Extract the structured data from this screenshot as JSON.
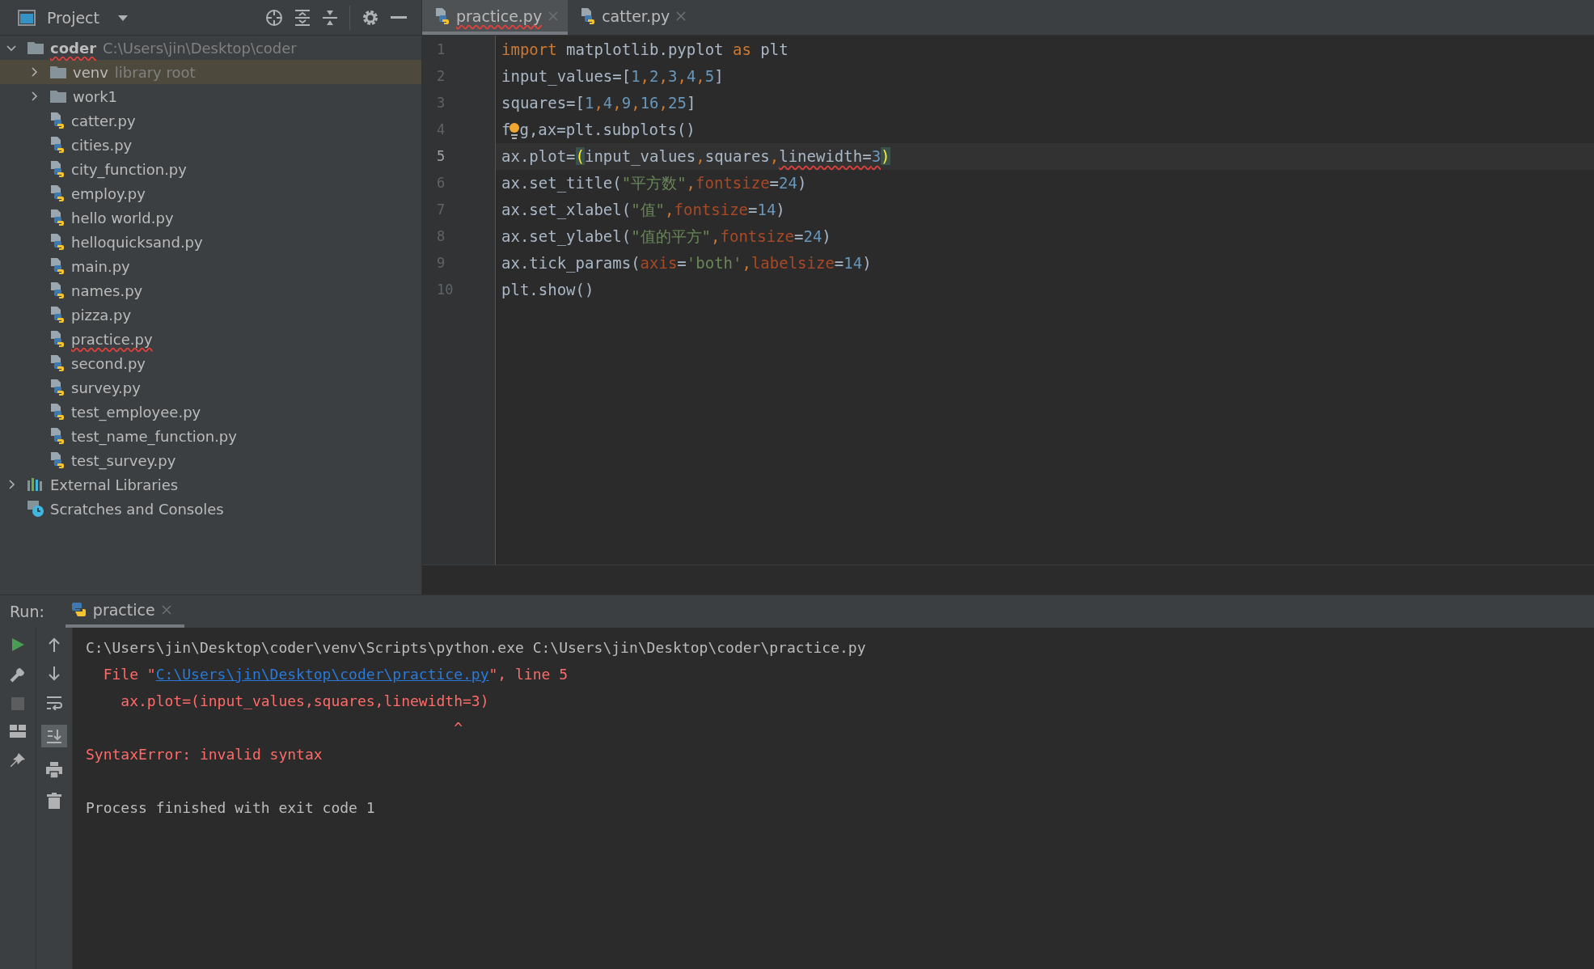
{
  "project_panel": {
    "title": "Project",
    "tree": [
      {
        "label": "coder",
        "hint": "C:\\Users\\jin\\Desktop\\coder",
        "kind": "folder",
        "expanded": true,
        "selected": false,
        "error": true,
        "children": [
          {
            "label": "venv",
            "hint": "library root",
            "kind": "folder",
            "expanded": false,
            "selected": true,
            "error": false
          },
          {
            "label": "work1",
            "kind": "folder",
            "expanded": false,
            "selected": false,
            "error": false
          },
          {
            "label": "catter.py",
            "kind": "python",
            "selected": false,
            "error": false
          },
          {
            "label": "cities.py",
            "kind": "python",
            "selected": false,
            "error": false
          },
          {
            "label": "city_function.py",
            "kind": "python",
            "selected": false,
            "error": false
          },
          {
            "label": "employ.py",
            "kind": "python",
            "selected": false,
            "error": false
          },
          {
            "label": "hello world.py",
            "kind": "python",
            "selected": false,
            "error": false
          },
          {
            "label": "helloquicksand.py",
            "kind": "python",
            "selected": false,
            "error": false
          },
          {
            "label": "main.py",
            "kind": "python",
            "selected": false,
            "error": false
          },
          {
            "label": "names.py",
            "kind": "python",
            "selected": false,
            "error": false
          },
          {
            "label": "pizza.py",
            "kind": "python",
            "selected": false,
            "error": false
          },
          {
            "label": "practice.py",
            "kind": "python",
            "selected": false,
            "error": true
          },
          {
            "label": "second.py",
            "kind": "python",
            "selected": false,
            "error": false
          },
          {
            "label": "survey.py",
            "kind": "python",
            "selected": false,
            "error": false
          },
          {
            "label": "test_employee.py",
            "kind": "python",
            "selected": false,
            "error": false
          },
          {
            "label": "test_name_function.py",
            "kind": "python",
            "selected": false,
            "error": false
          },
          {
            "label": "test_survey.py",
            "kind": "python",
            "selected": false,
            "error": false
          }
        ]
      },
      {
        "label": "External Libraries",
        "kind": "libraries",
        "expanded": false,
        "selected": false,
        "error": false
      },
      {
        "label": "Scratches and Consoles",
        "kind": "scratches",
        "selected": false,
        "error": false
      }
    ]
  },
  "editor_tabs": [
    {
      "label": "practice.py",
      "selected": true,
      "error": true
    },
    {
      "label": "catter.py",
      "selected": false,
      "error": false
    }
  ],
  "code_lines": [
    {
      "number": "1",
      "current": false,
      "tokens": [
        {
          "text": "import",
          "kind": "keyword"
        },
        {
          "text": " matplotlib.pyplot ",
          "kind": "plain"
        },
        {
          "text": "as",
          "kind": "keyword"
        },
        {
          "text": " plt",
          "kind": "plain"
        }
      ]
    },
    {
      "number": "2",
      "current": false,
      "tokens": [
        {
          "text": "input_values=[",
          "kind": "plain"
        },
        {
          "text": "1",
          "kind": "number"
        },
        {
          "text": ",",
          "kind": "keyword"
        },
        {
          "text": "2",
          "kind": "number"
        },
        {
          "text": ",",
          "kind": "keyword"
        },
        {
          "text": "3",
          "kind": "number"
        },
        {
          "text": ",",
          "kind": "keyword"
        },
        {
          "text": "4",
          "kind": "number"
        },
        {
          "text": ",",
          "kind": "keyword"
        },
        {
          "text": "5",
          "kind": "number"
        },
        {
          "text": "]",
          "kind": "plain"
        }
      ]
    },
    {
      "number": "3",
      "current": false,
      "tokens": [
        {
          "text": "squares=[",
          "kind": "plain"
        },
        {
          "text": "1",
          "kind": "number"
        },
        {
          "text": ",",
          "kind": "keyword"
        },
        {
          "text": "4",
          "kind": "number"
        },
        {
          "text": ",",
          "kind": "keyword"
        },
        {
          "text": "9",
          "kind": "number"
        },
        {
          "text": ",",
          "kind": "keyword"
        },
        {
          "text": "16",
          "kind": "number"
        },
        {
          "text": ",",
          "kind": "keyword"
        },
        {
          "text": "25",
          "kind": "number"
        },
        {
          "text": "]",
          "kind": "plain"
        }
      ]
    },
    {
      "number": "4",
      "current": false,
      "bulb": true,
      "tokens": [
        {
          "text": "f",
          "kind": "plain"
        },
        {
          "text": "g,ax=plt.subplots()",
          "kind": "plain"
        }
      ]
    },
    {
      "number": "5",
      "current": true,
      "tokens": [
        {
          "text": "ax.plot=",
          "kind": "plain"
        },
        {
          "text": "(",
          "kind": "bracket"
        },
        {
          "text": "input_values",
          "kind": "plain"
        },
        {
          "text": ",",
          "kind": "keyword"
        },
        {
          "text": "squares",
          "kind": "plain"
        },
        {
          "text": ",",
          "kind": "keyword"
        },
        {
          "text": "linewidth=",
          "kind": "plain",
          "error": true
        },
        {
          "text": "3",
          "kind": "number",
          "error": true
        },
        {
          "text": ")",
          "kind": "bracket"
        }
      ]
    },
    {
      "number": "6",
      "current": false,
      "tokens": [
        {
          "text": "ax.set_title(",
          "kind": "plain"
        },
        {
          "text": "\"平方数\"",
          "kind": "string"
        },
        {
          "text": ",",
          "kind": "keyword"
        },
        {
          "text": "fontsize",
          "kind": "param"
        },
        {
          "text": "=",
          "kind": "plain"
        },
        {
          "text": "24",
          "kind": "number"
        },
        {
          "text": ")",
          "kind": "plain"
        }
      ]
    },
    {
      "number": "7",
      "current": false,
      "tokens": [
        {
          "text": "ax.set_xlabel(",
          "kind": "plain"
        },
        {
          "text": "\"值\"",
          "kind": "string"
        },
        {
          "text": ",",
          "kind": "keyword"
        },
        {
          "text": "fontsize",
          "kind": "param"
        },
        {
          "text": "=",
          "kind": "plain"
        },
        {
          "text": "14",
          "kind": "number"
        },
        {
          "text": ")",
          "kind": "plain"
        }
      ]
    },
    {
      "number": "8",
      "current": false,
      "tokens": [
        {
          "text": "ax.set_ylabel(",
          "kind": "plain"
        },
        {
          "text": "\"值的平方\"",
          "kind": "string"
        },
        {
          "text": ",",
          "kind": "keyword"
        },
        {
          "text": "fontsize",
          "kind": "param"
        },
        {
          "text": "=",
          "kind": "plain"
        },
        {
          "text": "24",
          "kind": "number"
        },
        {
          "text": ")",
          "kind": "plain"
        }
      ]
    },
    {
      "number": "9",
      "current": false,
      "tokens": [
        {
          "text": "ax.tick_params(",
          "kind": "plain"
        },
        {
          "text": "axis",
          "kind": "param"
        },
        {
          "text": "=",
          "kind": "plain"
        },
        {
          "text": "'both'",
          "kind": "string"
        },
        {
          "text": ",",
          "kind": "keyword"
        },
        {
          "text": "labelsize",
          "kind": "param"
        },
        {
          "text": "=",
          "kind": "plain"
        },
        {
          "text": "14",
          "kind": "number"
        },
        {
          "text": ")",
          "kind": "plain"
        }
      ]
    },
    {
      "number": "10",
      "current": false,
      "tokens": [
        {
          "text": "plt.show()",
          "kind": "plain"
        }
      ]
    }
  ],
  "run_panel": {
    "label": "Run:",
    "tab": "practice",
    "console_lines": [
      {
        "kind": "normal",
        "parts": [
          {
            "text": "C:\\Users\\jin\\Desktop\\coder\\venv\\Scripts\\python.exe C:\\Users\\jin\\Desktop\\coder\\practice.py",
            "link": false
          }
        ]
      },
      {
        "kind": "error",
        "parts": [
          {
            "text": "  File \"",
            "link": false
          },
          {
            "text": "C:\\Users\\jin\\Desktop\\coder\\practice.py",
            "link": true
          },
          {
            "text": "\", line 5",
            "link": false
          }
        ]
      },
      {
        "kind": "error",
        "parts": [
          {
            "text": "    ax.plot=(input_values,squares,linewidth=3)",
            "link": false
          }
        ]
      },
      {
        "kind": "error",
        "parts": [
          {
            "text": "                                          ^",
            "link": false
          }
        ]
      },
      {
        "kind": "error",
        "parts": [
          {
            "text": "SyntaxError: invalid syntax",
            "link": false
          }
        ]
      },
      {
        "kind": "blank"
      },
      {
        "kind": "normal",
        "parts": [
          {
            "text": "Process finished with exit code 1",
            "link": false
          }
        ]
      }
    ]
  }
}
